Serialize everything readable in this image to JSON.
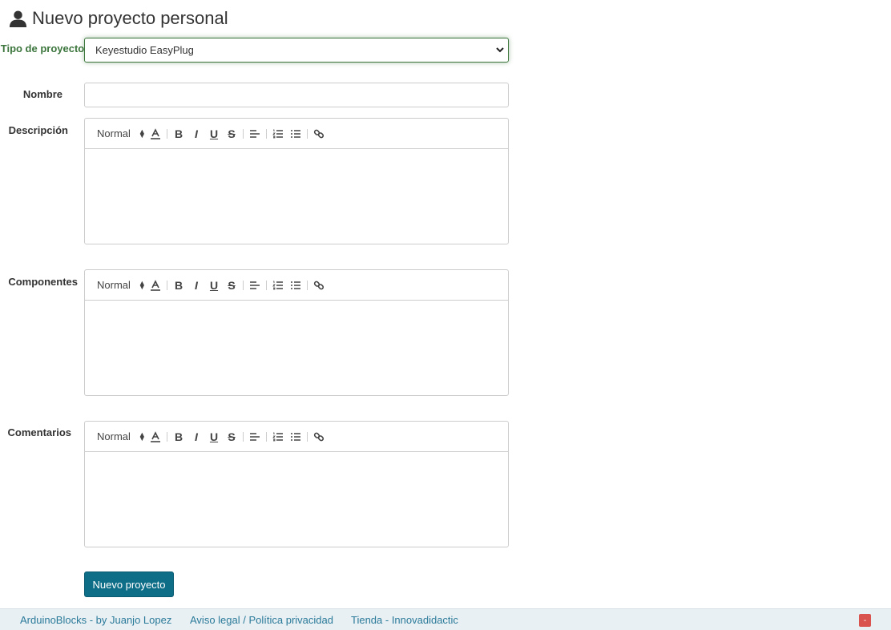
{
  "page": {
    "title": "Nuevo proyecto personal"
  },
  "form": {
    "tipo": {
      "label": "Tipo de proyecto",
      "selected": "Keyestudio EasyPlug"
    },
    "nombre": {
      "label": "Nombre",
      "value": ""
    },
    "descripcion": {
      "label": "Descripción"
    },
    "componentes": {
      "label": "Componentes"
    },
    "comentarios": {
      "label": "Comentarios"
    },
    "toolbar": {
      "header_label": "Normal",
      "bold": "B",
      "italic": "I",
      "underline": "U",
      "strike": "S"
    },
    "submit_label": "Nuevo proyecto"
  },
  "footer": {
    "link1": "ArduinoBlocks - by Juanjo Lopez",
    "link2a": "Aviso legal",
    "separator": " / ",
    "link2b": "Política privacidad",
    "link3": "Tienda - Innovadidactic",
    "badge": "-"
  },
  "colors": {
    "accent": "#0e6d87",
    "success": "#3c763d",
    "footer_bg": "#e9f0f3",
    "link": "#2a7a9a",
    "danger": "#d9534f"
  }
}
